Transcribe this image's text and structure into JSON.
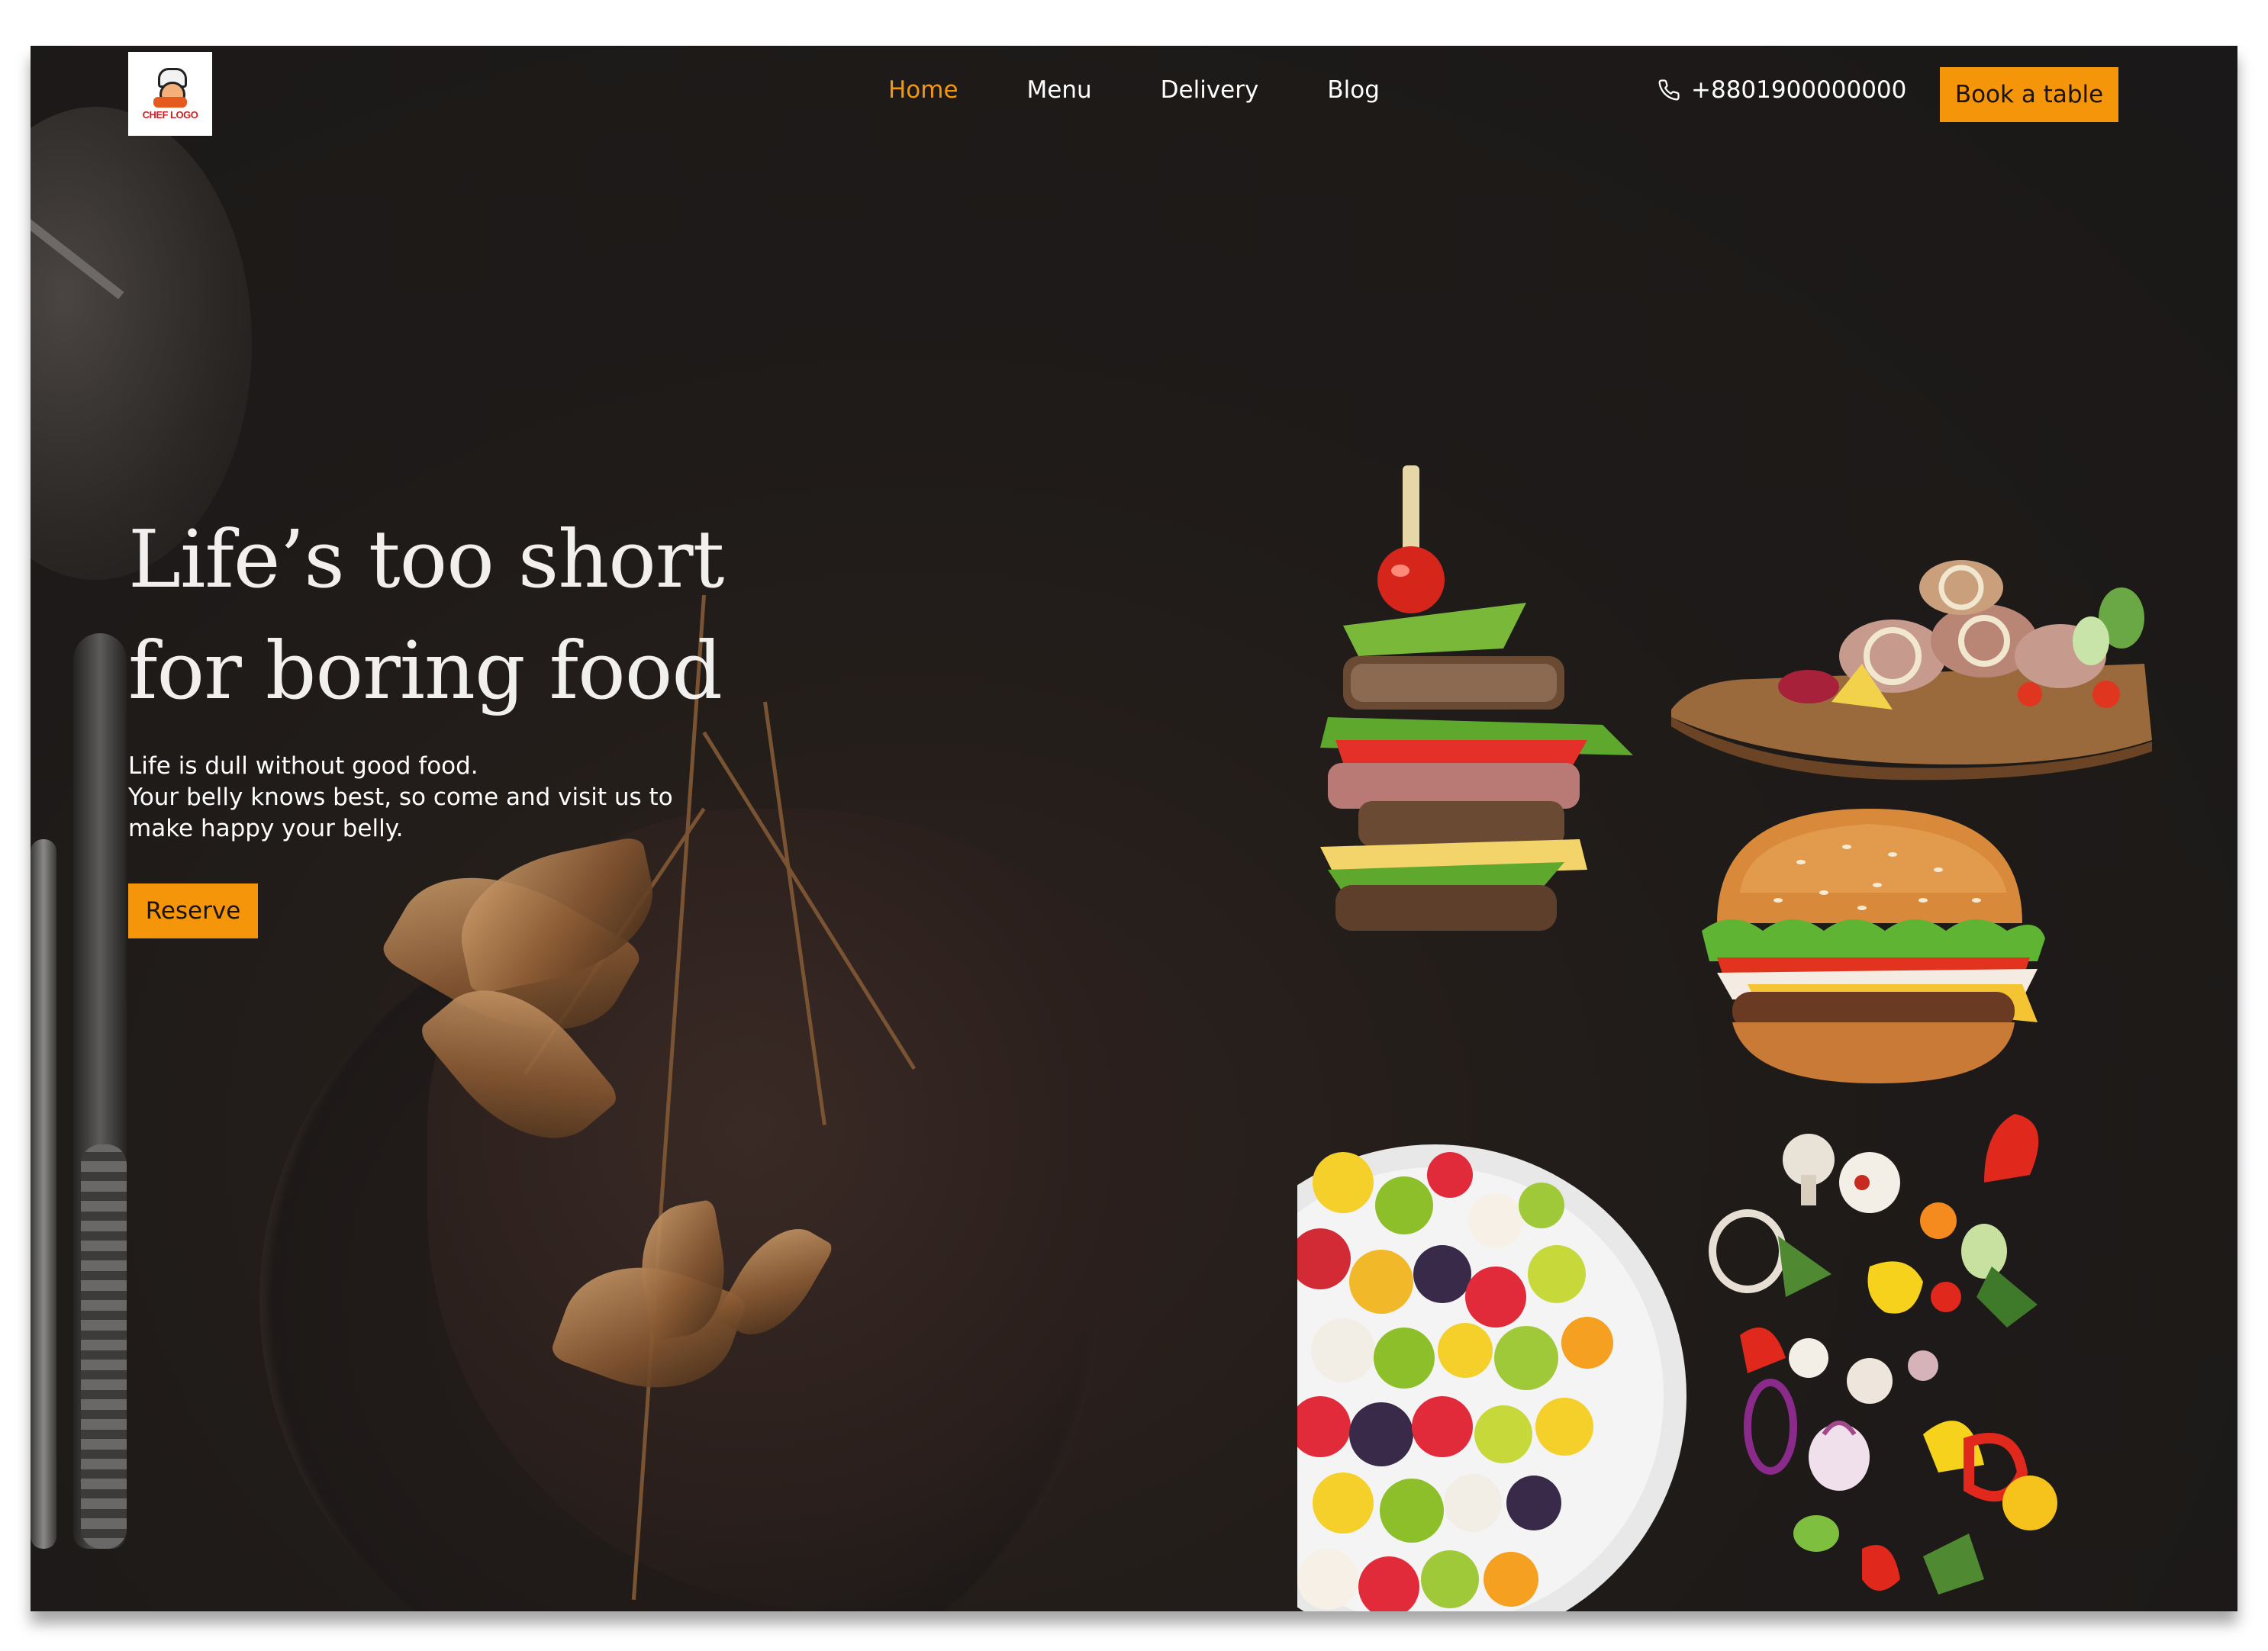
{
  "header": {
    "logo_text": "CHEF LOGO",
    "nav": [
      {
        "label": "Home",
        "active": true
      },
      {
        "label": "Menu",
        "active": false
      },
      {
        "label": "Delivery",
        "active": false
      },
      {
        "label": "Blog",
        "active": false
      }
    ],
    "phone": "+8801900000000",
    "phone_icon": "phone-icon",
    "cta_label": "Book a table"
  },
  "hero": {
    "title_line1": "Life’s too short",
    "title_line2": "for boring food",
    "copy_line1": "Life is dull without good food.",
    "copy_line2": "Your belly knows best, so come and visit us to",
    "copy_line3": "make happy your belly.",
    "reserve_label": "Reserve"
  },
  "colors": {
    "accent": "#f5960a",
    "background": "#1e1a19",
    "text": "#ffffff"
  },
  "images": [
    "sandwich",
    "meat-platter",
    "burger",
    "fruit-salad",
    "vegetables"
  ]
}
